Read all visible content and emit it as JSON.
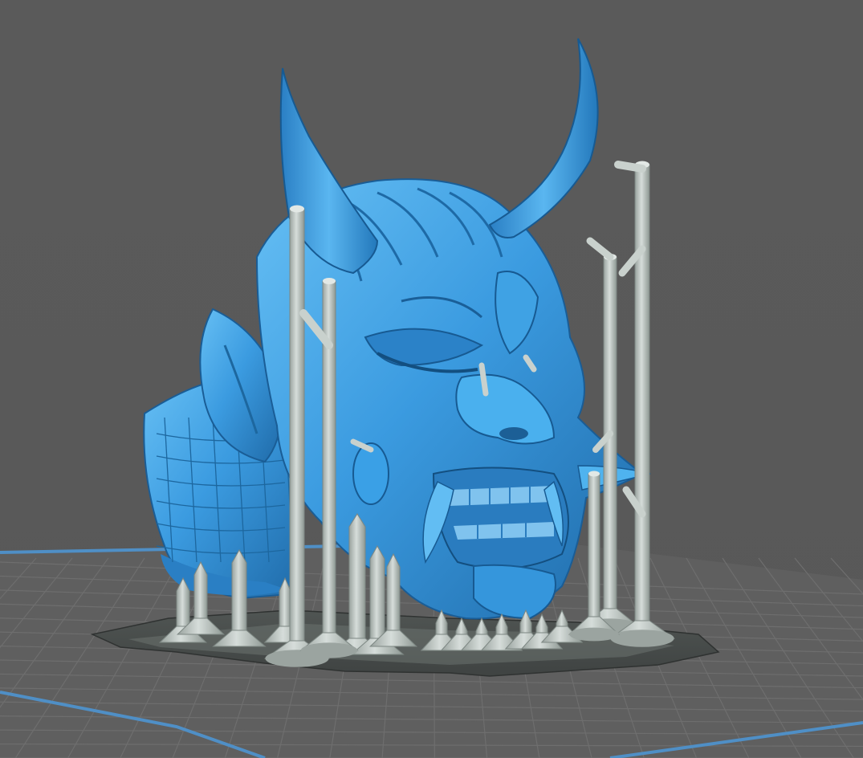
{
  "viewport": {
    "background_color": "#595959",
    "build_plate_grid_color": "#6a6a6a",
    "build_plate_border_color": "#4f8fc6",
    "model_color": "#3b9be0",
    "model_shadow_color": "#1f6aa8",
    "model_highlight_color": "#6ec3f5",
    "support_color": "#bfc8c4",
    "support_shadow_color": "#8e9893",
    "raft_color": "#4a4f4d"
  },
  "scene": {
    "model": "horned-oni-mask-icon",
    "supports": "support-pillars-icon",
    "raft": "support-raft-icon",
    "plate": "build-plate-grid-icon"
  }
}
